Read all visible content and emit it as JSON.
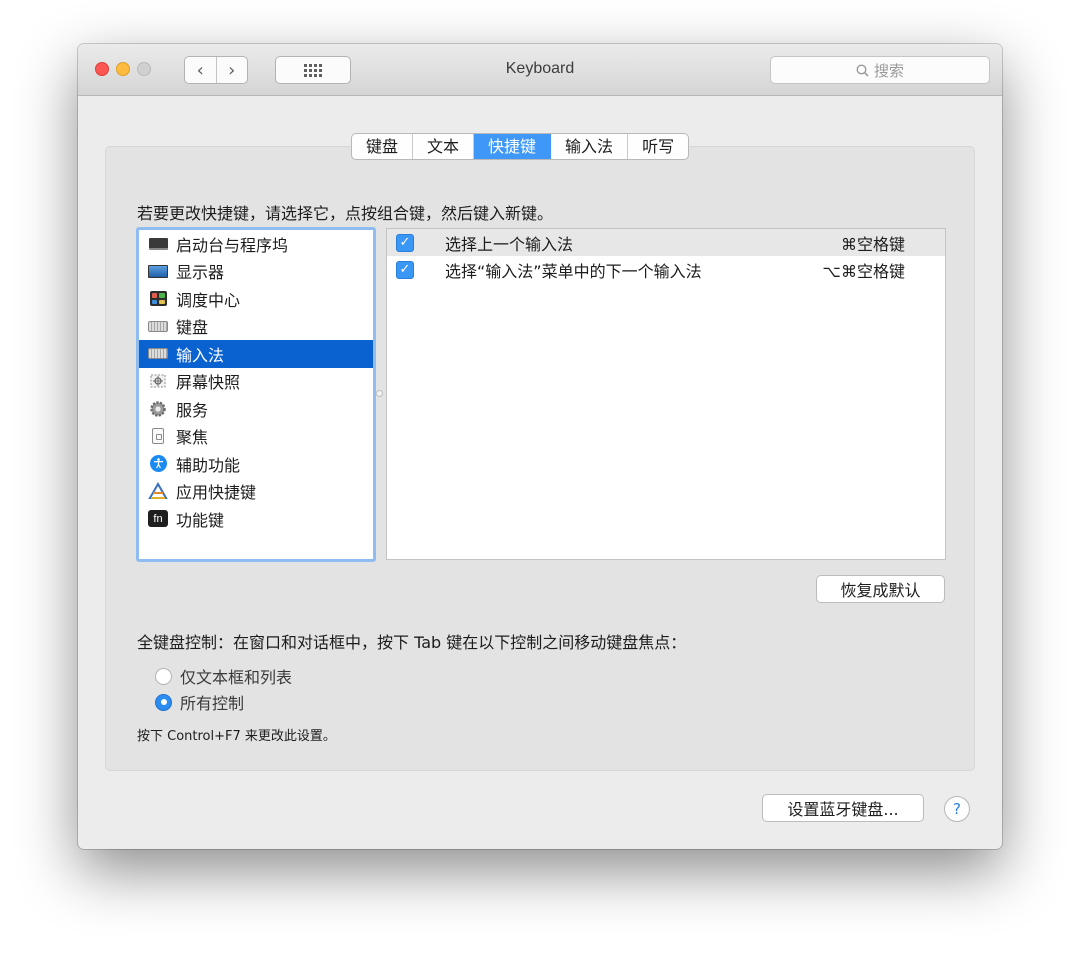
{
  "window": {
    "title": "Keyboard",
    "search_placeholder": "搜索",
    "nav": {
      "back": "‹",
      "forward": "›"
    }
  },
  "tabs": [
    {
      "label": "键盘",
      "active": false
    },
    {
      "label": "文本",
      "active": false
    },
    {
      "label": "快捷键",
      "active": true
    },
    {
      "label": "输入法",
      "active": false
    },
    {
      "label": "听写",
      "active": false
    }
  ],
  "instruction": "若要更改快捷键，请选择它，点按组合键，然后键入新键。",
  "categories": [
    {
      "label": "启动台与程序坞",
      "icon": "launchpad-icon"
    },
    {
      "label": "显示器",
      "icon": "display-icon"
    },
    {
      "label": "调度中心",
      "icon": "mission-control-icon"
    },
    {
      "label": "键盘",
      "icon": "keyboard-icon"
    },
    {
      "label": "输入法",
      "icon": "keyboard-icon",
      "selected": true
    },
    {
      "label": "屏幕快照",
      "icon": "screenshot-icon"
    },
    {
      "label": "服务",
      "icon": "gear-icon"
    },
    {
      "label": "聚焦",
      "icon": "spotlight-icon"
    },
    {
      "label": "辅助功能",
      "icon": "accessibility-icon"
    },
    {
      "label": "应用快捷键",
      "icon": "app-shortcuts-icon"
    },
    {
      "label": "功能键",
      "icon": "fn-key-icon",
      "icon_text": "fn"
    }
  ],
  "shortcuts": [
    {
      "checked": true,
      "check": "✓",
      "label": "选择上一个输入法",
      "key": "⌘空格键"
    },
    {
      "checked": true,
      "check": "✓",
      "label": "选择“输入法”菜单中的下一个输入法",
      "key": "⌥⌘空格键"
    }
  ],
  "restore_defaults": "恢复成默认",
  "full_keyboard": {
    "label": "全键盘控制：在窗口和对话框中，按下 Tab 键在以下控制之间移动键盘焦点：",
    "options": [
      {
        "label": "仅文本框和列表",
        "selected": false
      },
      {
        "label": "所有控制",
        "selected": true
      }
    ],
    "hint": "按下 Control+F7 来更改此设置。"
  },
  "bluetooth_button": "设置蓝牙键盘...",
  "help_button": "?",
  "colors": {
    "accent": "#3f98f7",
    "selection": "#0a62d1",
    "close": "#fc5753",
    "minimize": "#fdbc40",
    "zoom": "#d0d0d0"
  }
}
